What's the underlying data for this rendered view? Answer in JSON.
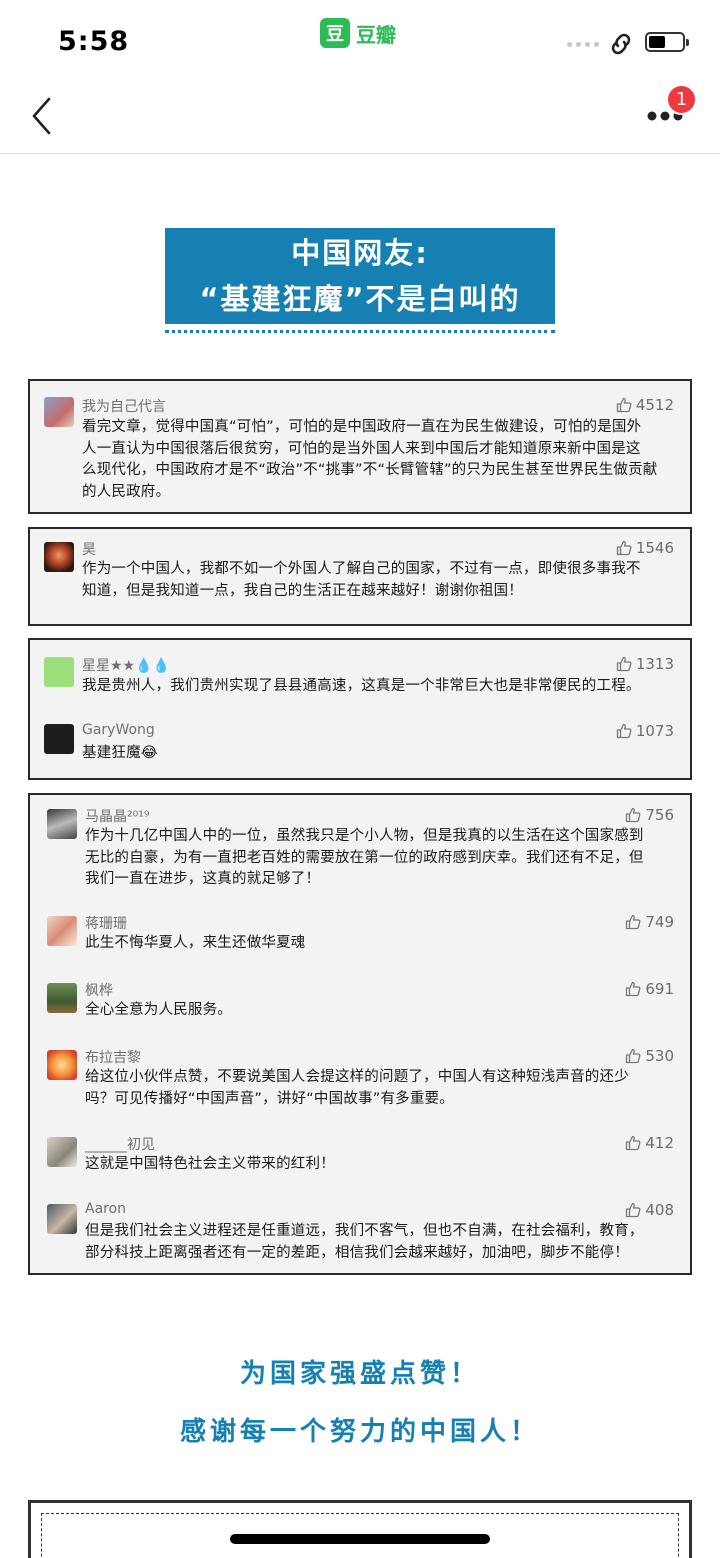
{
  "status_bar": {
    "time": "5:58",
    "app_icon_glyph": "豆",
    "app_name": "豆瓣"
  },
  "nav": {
    "notification_count": "1",
    "back_icon": "chevron-left-icon",
    "more_icon": "more-dots-icon"
  },
  "title": {
    "line1": "中国网友:",
    "line2": "“基建狂魔”不是白叫的"
  },
  "comments": [
    {
      "user": "我为自己代言",
      "likes": "4512",
      "lines": [
        "看完文章，觉得中国真“可怕”，可怕的是中国政府一直在为民生做建设，可怕的是国外",
        "人一直认为中国很落后很贫穷，可怕的是当外国人来到中国后才能知道原来新中国是这",
        "么现代化，中国政府才是不“政治”不“挑事”不“长臂管辖”的只为民生甚至世界民生做贡献",
        "的人民政府。"
      ]
    },
    {
      "user": "昊",
      "likes": "1546",
      "lines": [
        "作为一个中国人，我都不如一个外国人了解自己的国家，不过有一点，即使很多事我不",
        "知道，但是我知道一点，我自己的生活正在越来越好！谢谢你祖国！"
      ]
    },
    {
      "user": "星星★★💧💧",
      "likes": "1313",
      "lines": [
        "我是贵州人，我们贵州实现了县县通高速，这真是一个非常巨大也是非常便民的工程。"
      ]
    },
    {
      "user": "GaryWong",
      "likes": "1073",
      "lines": [
        "基建狂魔😂"
      ]
    },
    {
      "user": "马晶晶²⁰¹⁹",
      "likes": "756",
      "lines": [
        "作为十几亿中国人中的一位，虽然我只是个小人物，但是我真的以生活在这个国家感到",
        "无比的自豪，为有一直把老百姓的需要放在第一位的政府感到庆幸。我们还有不足，但",
        "我们一直在进步，这真的就足够了！"
      ]
    },
    {
      "user": "蒋珊珊",
      "likes": "749",
      "lines": [
        "此生不悔华夏人，来生还做华夏魂"
      ]
    },
    {
      "user": "枫桦",
      "likes": "691",
      "lines": [
        "全心全意为人民服务。"
      ]
    },
    {
      "user": "布拉吉黎",
      "likes": "530",
      "lines": [
        "给这位小伙伴点赞，不要说美国人会提这样的问题了，中国人有这种短浅声音的还少",
        "吗？可见传播好“中国声音”，讲好“中国故事”有多重要。"
      ]
    },
    {
      "user": "______初见",
      "likes": "412",
      "lines": [
        "这就是中国特色社会主义带来的红利！"
      ]
    },
    {
      "user": "Aaron",
      "likes": "408",
      "lines": [
        "但是我们社会主义进程还是任重道远，我们不客气，但也不自满，在社会福利，教育，",
        "部分科技上距离强者还有一定的差距，相信我们会越来越好，加油吧，脚步不能停！"
      ]
    }
  ],
  "footer": {
    "slogan1": "为国家强盛点赞！",
    "slogan2": "感谢每一个努力的中国人！"
  },
  "colors": {
    "accent": "#1580b1",
    "brand_green": "#2dbb55",
    "badge_red": "#ee3a3f"
  }
}
